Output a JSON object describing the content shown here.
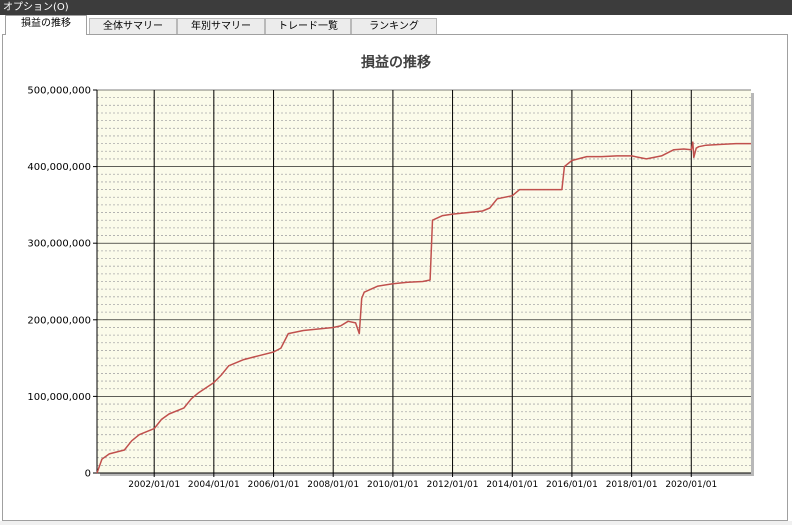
{
  "menu": {
    "options_label": "オプション(O)"
  },
  "tabs": [
    {
      "label": "損益の推移",
      "active": true
    },
    {
      "label": "全体サマリー",
      "active": false
    },
    {
      "label": "年別サマリー",
      "active": false
    },
    {
      "label": "トレード一覧",
      "active": false
    },
    {
      "label": "ランキング",
      "active": false
    }
  ],
  "chart_data": {
    "type": "line",
    "title": "損益の推移",
    "xlabel": "",
    "ylabel": "",
    "ylim": [
      0,
      500000000
    ],
    "xlim": [
      "2000/02/01",
      "2022/01/01"
    ],
    "y_ticks": [
      "0",
      "100,000,000",
      "200,000,000",
      "300,000,000",
      "400,000,000",
      "500,000,000"
    ],
    "x_ticks": [
      "2002/01/01",
      "2004/01/01",
      "2006/01/01",
      "2008/01/01",
      "2010/01/01",
      "2012/01/01",
      "2014/01/01",
      "2016/01/01",
      "2018/01/01",
      "2020/01/01"
    ],
    "grid": true,
    "legend": "none",
    "colors": {
      "plot_bg": "#fbfbea",
      "line": "#c0504d",
      "grid_major": "#000000",
      "grid_minor": "#a9a9a9"
    },
    "series": [
      {
        "x": [
          "2000/02/01",
          "2000/04/01",
          "2000/07/01",
          "2001/01/01",
          "2001/04/01",
          "2001/07/01",
          "2002/01/01",
          "2002/04/01",
          "2002/07/01",
          "2003/01/01",
          "2003/04/01",
          "2003/07/01",
          "2004/01/01",
          "2004/04/01",
          "2004/07/01",
          "2005/01/01",
          "2005/07/01",
          "2006/01/01",
          "2006/04/01",
          "2006/07/01",
          "2007/01/01",
          "2007/07/01",
          "2008/01/01",
          "2008/04/01",
          "2008/07/01",
          "2008/10/01",
          "2008/11/15",
          "2008/12/15",
          "2009/01/15",
          "2009/07/01",
          "2010/01/01",
          "2010/07/01",
          "2011/01/01",
          "2011/04/01",
          "2011/05/01",
          "2011/09/01",
          "2012/01/01",
          "2012/07/01",
          "2013/01/01",
          "2013/04/01",
          "2013/07/01",
          "2014/01/01",
          "2014/04/01",
          "2014/07/01",
          "2015/01/01",
          "2015/07/01",
          "2015/09/01",
          "2015/10/01",
          "2016/01/01",
          "2016/07/01",
          "2017/01/01",
          "2017/07/01",
          "2018/01/01",
          "2018/07/01",
          "2019/01/01",
          "2019/06/01",
          "2019/10/01",
          "2020/01/01",
          "2020/01/20",
          "2020/02/01",
          "2020/03/01",
          "2020/04/01",
          "2020/07/01",
          "2021/01/01",
          "2021/07/01",
          "2022/01/01"
        ],
        "values": [
          0,
          18000000,
          25000000,
          30000000,
          42000000,
          50000000,
          58000000,
          70000000,
          77000000,
          85000000,
          97000000,
          105000000,
          118000000,
          128000000,
          140000000,
          148000000,
          153000000,
          158000000,
          163000000,
          182000000,
          186000000,
          188000000,
          190000000,
          192000000,
          198000000,
          196000000,
          182000000,
          228000000,
          236000000,
          244000000,
          247000000,
          249000000,
          250000000,
          252000000,
          330000000,
          336000000,
          338000000,
          340000000,
          342000000,
          346000000,
          358000000,
          362000000,
          370000000,
          370000000,
          370000000,
          370000000,
          370000000,
          400000000,
          408000000,
          413000000,
          413000000,
          414000000,
          414000000,
          410000000,
          414000000,
          422000000,
          423000000,
          422000000,
          432000000,
          412000000,
          424000000,
          426000000,
          428000000,
          429000000,
          430000000,
          430000000
        ]
      }
    ]
  }
}
